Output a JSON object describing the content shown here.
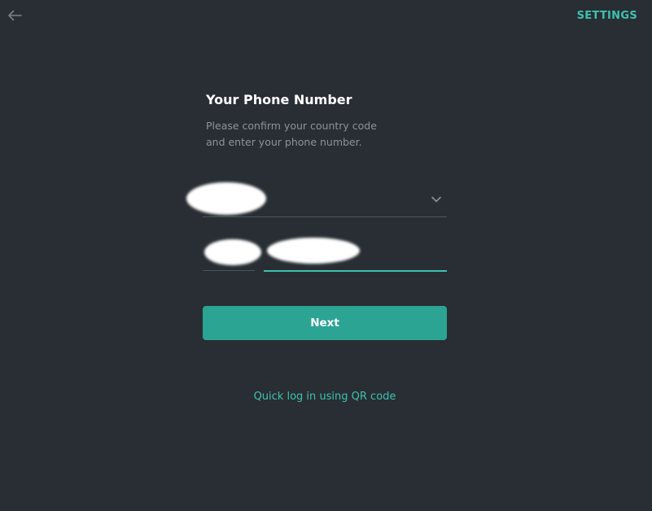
{
  "header": {
    "back_icon": "arrow-left-icon",
    "settings_label": "SETTINGS"
  },
  "main": {
    "title": "Your Phone Number",
    "subtitle": "Please confirm your country code\nand enter your phone number.",
    "country": {
      "value": "",
      "redacted": true,
      "dropdown_icon": "chevron-down-icon"
    },
    "country_code": {
      "value": "",
      "redacted": true
    },
    "phone_number": {
      "value": "",
      "redacted": true,
      "focused": true
    },
    "next_label": "Next",
    "qr_link_label": "Quick log in using QR code"
  },
  "colors": {
    "background": "#282e33",
    "accent": "#3fc1b0",
    "button": "#2ba493",
    "muted_text": "#8d939a",
    "divider": "#4d555d"
  }
}
